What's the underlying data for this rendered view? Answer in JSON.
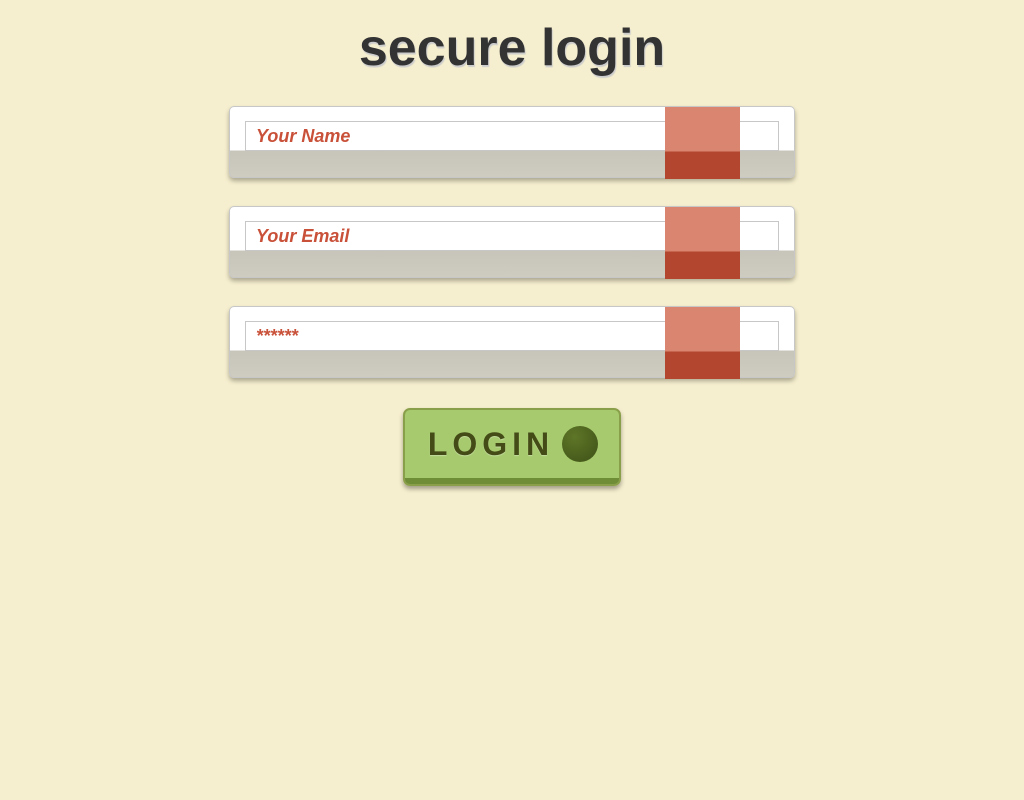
{
  "title": "secure login",
  "form": {
    "name": {
      "placeholder": "Your Name",
      "value": ""
    },
    "email": {
      "placeholder": "Your Email",
      "value": ""
    },
    "password": {
      "placeholder": "******",
      "value": ""
    },
    "submit_label": "LOGIN"
  },
  "colors": {
    "background": "#F6EFCF",
    "accent_ribbon": "#D98570",
    "button_green": "#A6CA6D",
    "placeholder_text": "#C95139"
  }
}
